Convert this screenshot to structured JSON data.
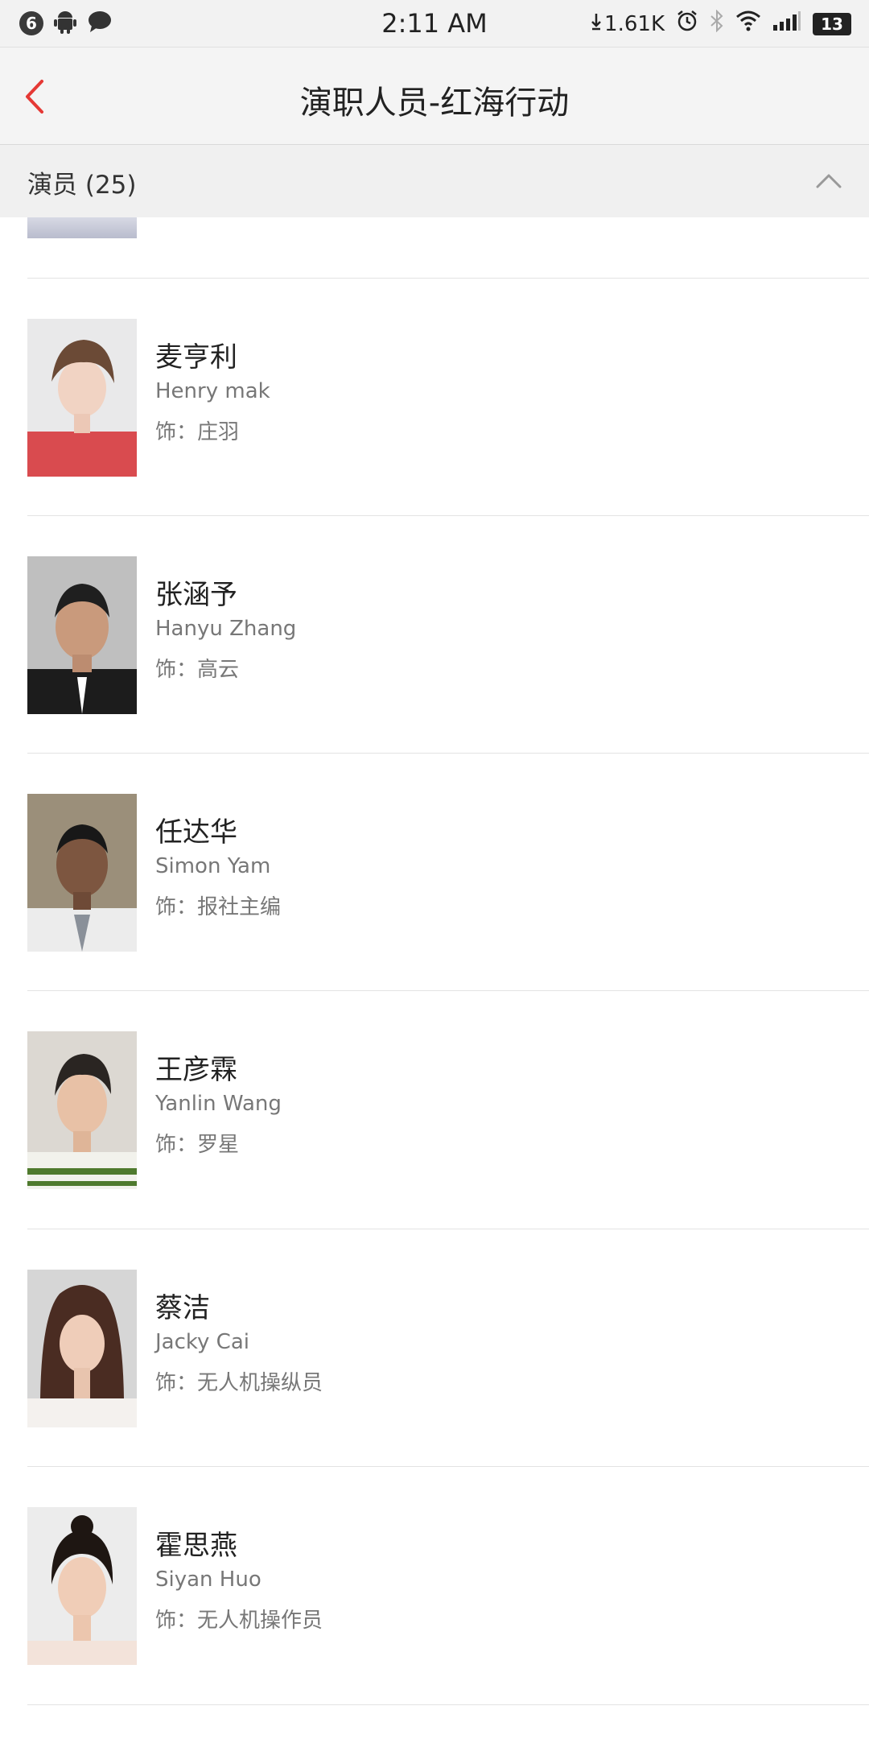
{
  "status_bar": {
    "notification_count": "6",
    "time": "2:11 AM",
    "network_speed": "1.61K",
    "battery": "13"
  },
  "header": {
    "title": "演职人员-红海行动"
  },
  "section": {
    "title": "演员 (25)"
  },
  "cast": [
    {
      "name": "麦亨利",
      "en_name": "Henry mak",
      "role": "饰：庄羽"
    },
    {
      "name": "张涵予",
      "en_name": "Hanyu Zhang",
      "role": "饰：高云"
    },
    {
      "name": "任达华",
      "en_name": "Simon Yam",
      "role": "饰：报社主编"
    },
    {
      "name": "王彦霖",
      "en_name": "Yanlin Wang",
      "role": "饰：罗星"
    },
    {
      "name": "蔡洁",
      "en_name": "Jacky Cai",
      "role": "饰：无人机操纵员"
    },
    {
      "name": "霍思燕",
      "en_name": "Siyan Huo",
      "role": "饰：无人机操作员"
    }
  ],
  "colors": {
    "accent": "#e53935",
    "title_text": "#222222",
    "secondary_text": "#777777"
  }
}
